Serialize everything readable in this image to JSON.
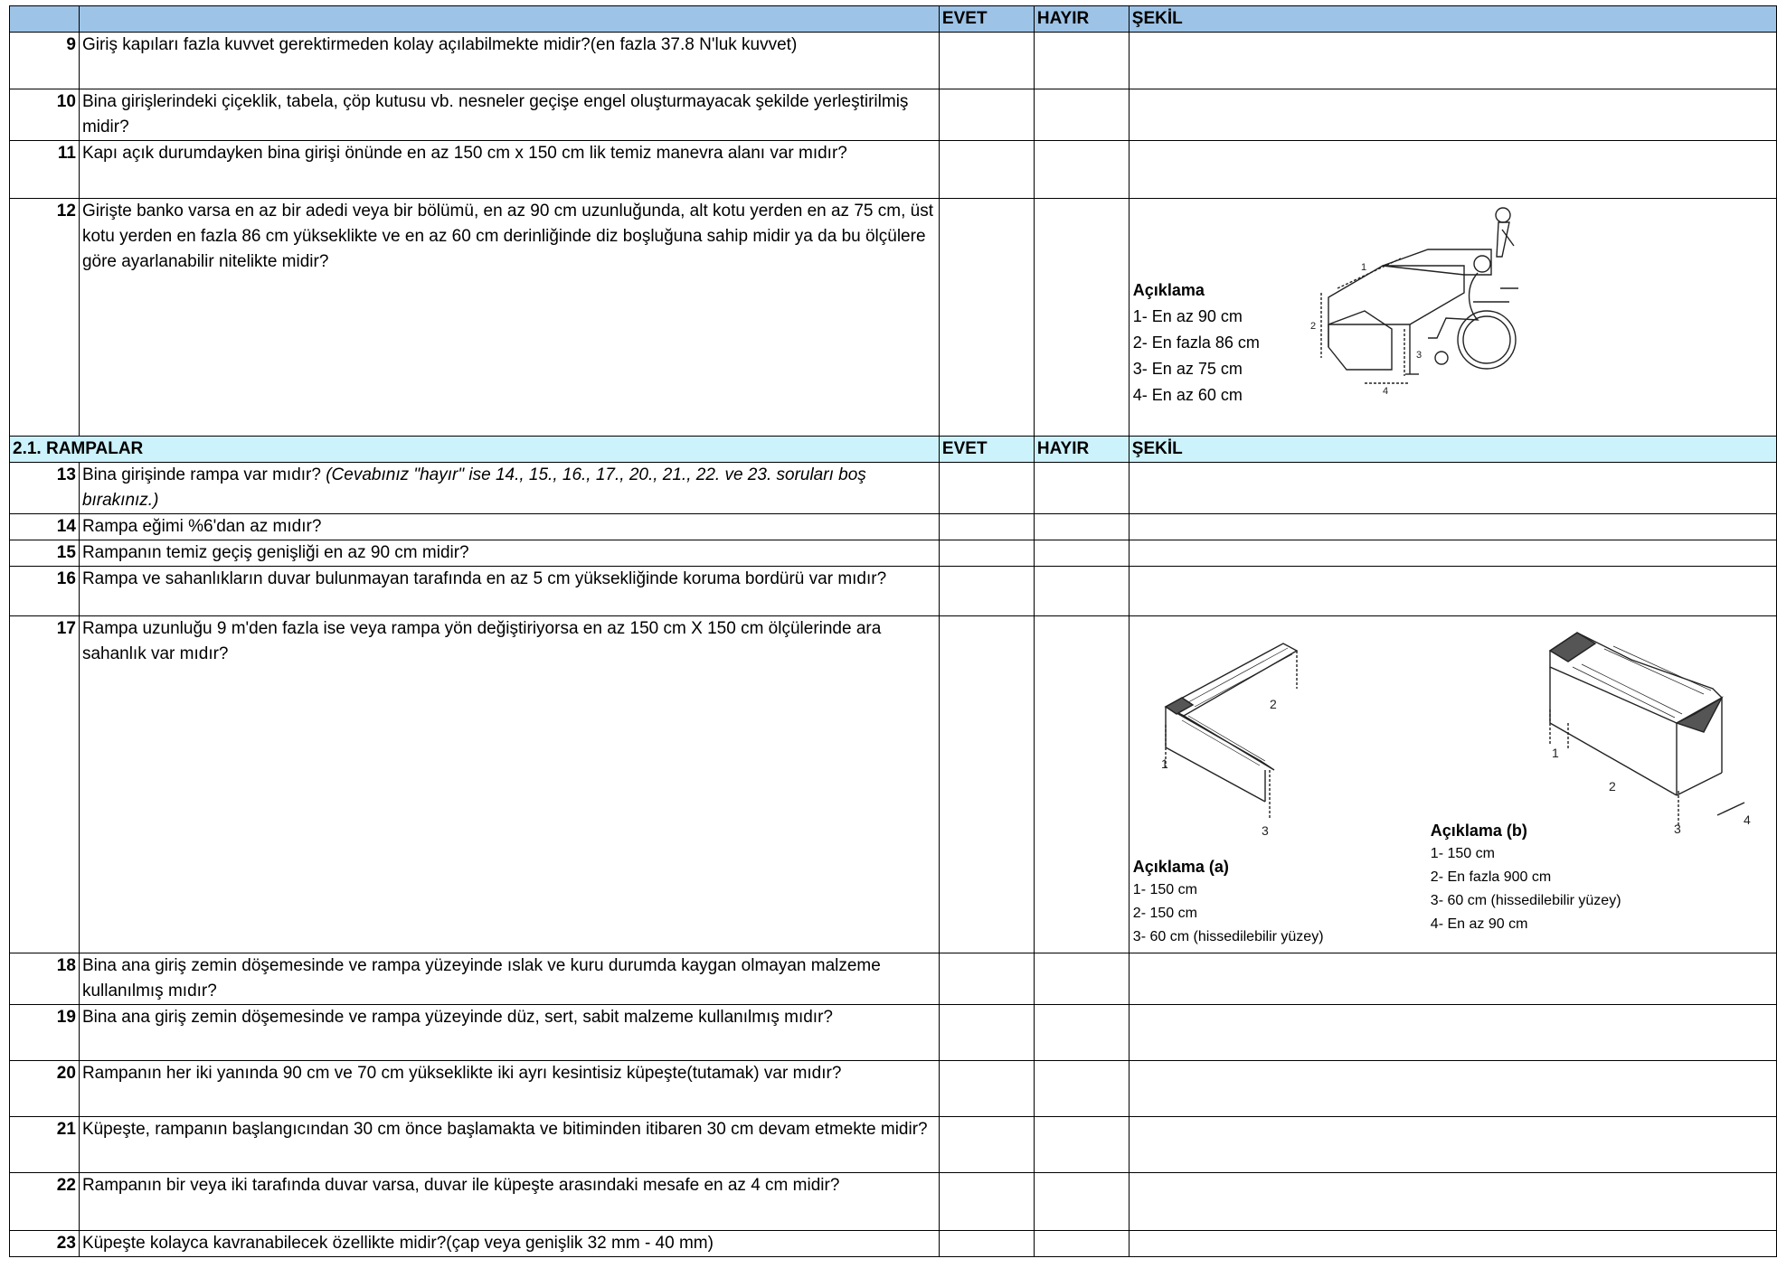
{
  "header": {
    "evet": "EVET",
    "hayir": "HAYIR",
    "sekil": "ŞEKİL"
  },
  "section_ramp": {
    "title": "2.1. RAMPALAR",
    "evet": "EVET",
    "hayir": "HAYIR",
    "sekil": "ŞEKİL"
  },
  "rows": [
    {
      "no": "9",
      "text": "Giriş kapıları fazla kuvvet gerektirmeden kolay açılabilmekte midir?(en fazla 37.8 N'luk kuvvet)"
    },
    {
      "no": "10",
      "text": "Bina girişlerindeki çiçeklik, tabela, çöp kutusu vb. nesneler geçişe engel oluşturmayacak şekilde yerleştirilmiş midir?"
    },
    {
      "no": "11",
      "text": " Kapı açık durumdayken bina girişi önünde en az 150 cm x 150 cm lik  temiz manevra alanı var mıdır?"
    },
    {
      "no": "12",
      "text": "Girişte banko varsa en az bir adedi veya bir bölümü, en az 90 cm uzunluğunda, alt kotu yerden en az 75 cm, üst kotu yerden en fazla 86 cm yükseklikte ve  en az  60 cm derinliğinde diz boşluğuna sahip midir ya da bu ölçülere göre ayarlanabilir nitelikte midir?"
    },
    {
      "no": "13",
      "text": "Bina girişinde rampa var mıdır? ",
      "note": "(Cevabınız \"hayır\" ise 14., 15., 16., 17., 20., 21., 22. ve 23. soruları boş bırakınız.)"
    },
    {
      "no": "14",
      "text": "Rampa eğimi %6'dan az mıdır?"
    },
    {
      "no": "15",
      "text": "Rampanın temiz geçiş genişliği en az 90 cm midir?"
    },
    {
      "no": "16",
      "text": "Rampa ve sahanlıkların duvar bulunmayan tarafında en az 5 cm yüksekliğinde koruma bordürü var mıdır?"
    },
    {
      "no": "17",
      "text": "Rampa uzunluğu 9 m'den fazla ise veya rampa yön değiştiriyorsa en az 150 cm X 150 cm ölçülerinde ara sahanlık var mıdır?"
    },
    {
      "no": "18",
      "text": "Bina ana giriş zemin döşemesinde ve rampa yüzeyinde ıslak ve kuru durumda kaygan olmayan malzeme kullanılmış mıdır?"
    },
    {
      "no": "19",
      "text": "Bina ana giriş zemin döşemesinde ve rampa yüzeyinde düz, sert, sabit   malzeme kullanılmış mıdır?"
    },
    {
      "no": "20",
      "text": "Rampanın her iki yanında 90 cm ve 70 cm yükseklikte iki ayrı kesintisiz küpeşte(tutamak) var mıdır?"
    },
    {
      "no": "21",
      "text": "Küpeşte, rampanın başlangıcından 30 cm önce başlamakta ve bitiminden itibaren 30 cm devam etmekte midir?"
    },
    {
      "no": "22",
      "text": "Rampanın bir veya iki tarafında duvar varsa, duvar ile küpeşte arasındaki mesafe en az 4 cm midir?"
    },
    {
      "no": "23",
      "text": "Küpeşte kolayca kavranabilecek özellikte midir?(çap veya genişlik 32 mm - 40 mm)"
    }
  ],
  "fig_counter": {
    "title": "Açıklama",
    "items": [
      "1- En az 90 cm",
      "2- En fazla 86 cm",
      "3- En az 75 cm",
      "4- En az 60 cm"
    ],
    "labels": [
      "1",
      "2",
      "3",
      "4"
    ]
  },
  "fig_ramp_a": {
    "title": "Açıklama (a)",
    "items": [
      "1- 150 cm",
      "2- 150 cm",
      "3- 60 cm (hissedilebilir yüzey)"
    ],
    "labels": [
      "1",
      "2",
      "3"
    ]
  },
  "fig_ramp_b": {
    "title": "Açıklama (b)",
    "items": [
      "1- 150 cm",
      "2- En fazla 900 cm",
      "3- 60 cm (hissedilebilir yüzey)",
      "4- En az 90 cm"
    ],
    "labels": [
      "1",
      "2",
      "3",
      "4"
    ]
  }
}
